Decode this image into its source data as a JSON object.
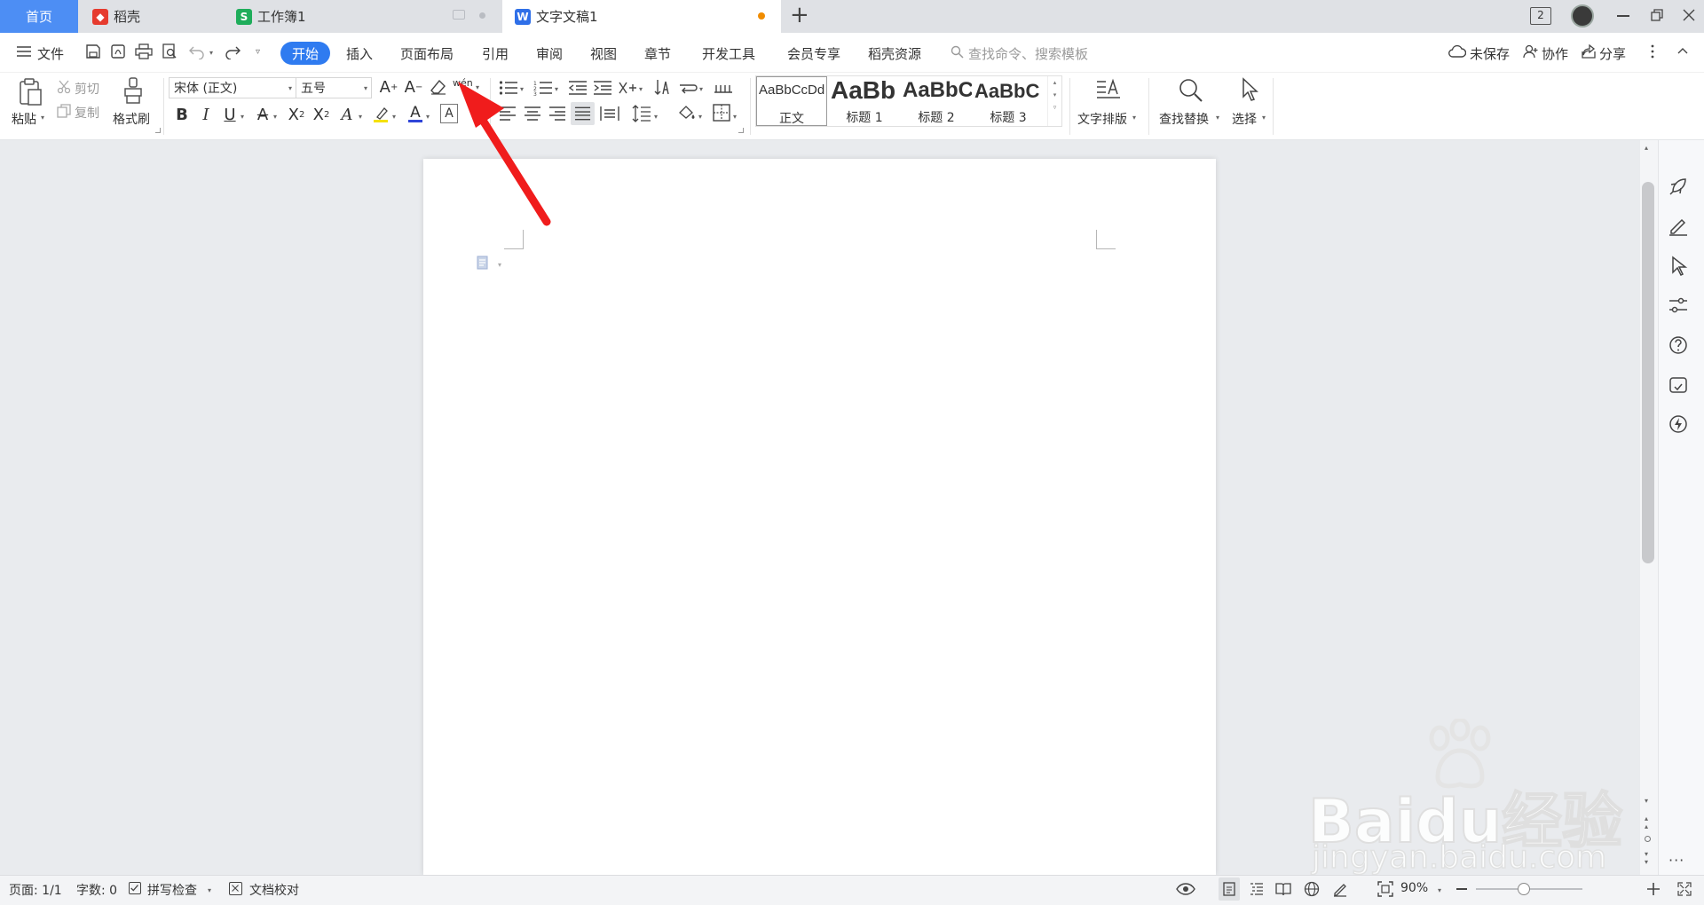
{
  "tabs": {
    "home": "首页",
    "daoke": "稻壳",
    "workbook": "工作簿1",
    "doc": "文字文稿1",
    "new_tab": "+",
    "window_count": "2"
  },
  "menu": {
    "file": "文件",
    "items": [
      "开始",
      "插入",
      "页面布局",
      "引用",
      "审阅",
      "视图",
      "章节",
      "开发工具",
      "会员专享",
      "稻壳资源"
    ],
    "search_placeholder": "查找命令、搜索模板",
    "unsaved": "未保存",
    "collab": "协作",
    "share": "分享"
  },
  "ribbon": {
    "paste": "粘贴",
    "cut": "剪切",
    "copy": "复制",
    "format_painter": "格式刷",
    "font_name": "宋体 (正文)",
    "font_size": "五号",
    "phonetic": "wén",
    "styles": [
      {
        "preview": "AaBbCcDd",
        "label": "正文"
      },
      {
        "preview": "AaBb",
        "label": "标题 1"
      },
      {
        "preview": "AaBbC",
        "label": "标题 2"
      },
      {
        "preview": "AaBbC",
        "label": "标题 3"
      }
    ],
    "text_layout": "文字排版",
    "find_replace": "查找替换",
    "select": "选择"
  },
  "status": {
    "page": "页面: 1/1",
    "words": "字数: 0",
    "spell": "拼写检查",
    "proof": "文档校对",
    "zoom": "90%",
    "zoom_level": 0.45
  },
  "watermark": {
    "brand": "Baidu",
    "cn": "经验",
    "url": "jingyan.baidu.com"
  },
  "colors": {
    "accent": "#2f7bf0",
    "home_tab": "#4d8ef4",
    "annotation_arrow": "#f01c1c",
    "doc_icon": "#2f6fe8",
    "sheet_icon": "#1fad5b",
    "daoke_icon": "#e63b2e"
  }
}
